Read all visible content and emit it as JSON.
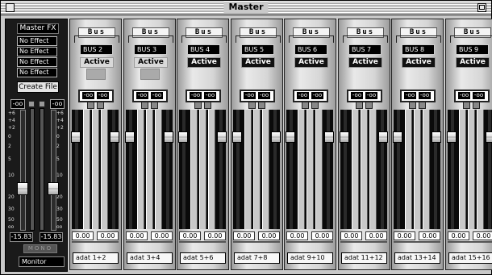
{
  "window": {
    "title": "Master"
  },
  "master": {
    "fx_title": "Master FX",
    "fx_slots": [
      "No Effect",
      "No Effect",
      "No Effect",
      "No Effect"
    ],
    "create_label": "Create File",
    "left_peak": "-oo",
    "right_peak": "-oo",
    "scale": [
      "+6",
      "+4",
      "+2",
      "0",
      "2",
      "5",
      "10",
      "20",
      "30",
      "50",
      "oo"
    ],
    "left_readout": "-15.83",
    "right_readout": "-15.83",
    "mono_label": "MONO",
    "monitor_label": "Monitor"
  },
  "buses": [
    {
      "header": "Bus",
      "name": "BUS 2",
      "status": "Active",
      "status_state": "off",
      "peak_l": "-oo",
      "peak_r": "-oo",
      "pan_l": "0.00",
      "pan_r": "0.00",
      "output": "adat 1+2"
    },
    {
      "header": "Bus",
      "name": "BUS 3",
      "status": "Active",
      "status_state": "off",
      "peak_l": "-oo",
      "peak_r": "-oo",
      "pan_l": "0.00",
      "pan_r": "0.00",
      "output": "adat 3+4"
    },
    {
      "header": "Bus",
      "name": "BUS 4",
      "status": "Active",
      "status_state": "on",
      "peak_l": "-oo",
      "peak_r": "-oo",
      "pan_l": "0.00",
      "pan_r": "0.00",
      "output": "adat 5+6"
    },
    {
      "header": "Bus",
      "name": "BUS 5",
      "status": "Active",
      "status_state": "on",
      "peak_l": "-oo",
      "peak_r": "-oo",
      "pan_l": "0.00",
      "pan_r": "0.00",
      "output": "adat 7+8"
    },
    {
      "header": "Bus",
      "name": "BUS 6",
      "status": "Active",
      "status_state": "on",
      "peak_l": "-oo",
      "peak_r": "-oo",
      "pan_l": "0.00",
      "pan_r": "0.00",
      "output": "adat 9+10"
    },
    {
      "header": "Bus",
      "name": "BUS 7",
      "status": "Active",
      "status_state": "on",
      "peak_l": "-oo",
      "peak_r": "-oo",
      "pan_l": "0.00",
      "pan_r": "0.00",
      "output": "adat 11+12"
    },
    {
      "header": "Bus",
      "name": "BUS 8",
      "status": "Active",
      "status_state": "on",
      "peak_l": "-oo",
      "peak_r": "-oo",
      "pan_l": "0.00",
      "pan_r": "0.00",
      "output": "adat 13+14"
    },
    {
      "header": "Bus",
      "name": "BUS 9",
      "status": "Active",
      "status_state": "on",
      "peak_l": "-oo",
      "peak_r": "-oo",
      "pan_l": "0.00",
      "pan_r": "0.00",
      "output": "adat 15+16"
    }
  ]
}
